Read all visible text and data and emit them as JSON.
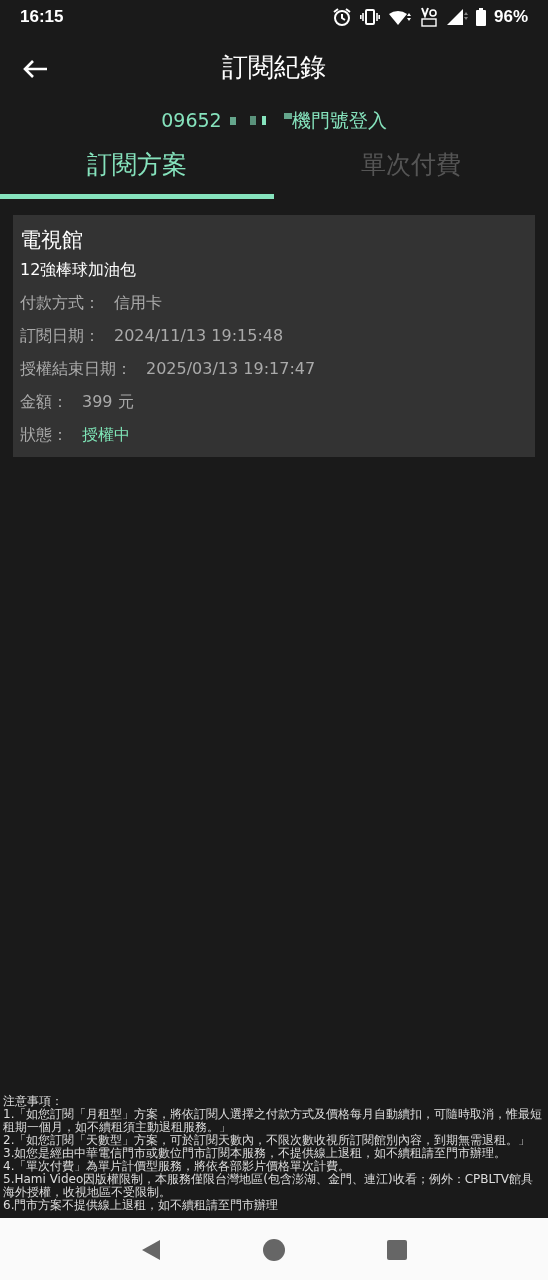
{
  "status_bar": {
    "time": "16:15",
    "battery": "96%"
  },
  "header": {
    "title": "訂閱紀錄"
  },
  "login": {
    "number_prefix": "09652",
    "suffix": "機門號登入"
  },
  "tabs": [
    {
      "label": "訂閱方案",
      "selected": true
    },
    {
      "label": "單次付費",
      "selected": false
    }
  ],
  "subscriptions": [
    {
      "category": "電視館",
      "plan": "12強棒球加油包",
      "fields": [
        {
          "label": "付款方式：",
          "value": "信用卡",
          "kind": "plain"
        },
        {
          "label": "訂閱日期：",
          "value": "2024/11/13 19:15:48",
          "kind": "plain"
        },
        {
          "label": "授權結束日期：",
          "value": "2025/03/13 19:17:47",
          "kind": "plain"
        },
        {
          "label": "金額：",
          "value": "399 元",
          "kind": "plain"
        },
        {
          "label": "狀態：",
          "value": "授權中",
          "kind": "status"
        }
      ]
    }
  ],
  "notes": {
    "heading": "注意事項：",
    "items": [
      "1.「如您訂閱「月租型」方案，將依訂閱人選擇之付款方式及價格每月自動續扣，可隨時取消，惟最短租期一個月，如不續租須主動退租服務。」",
      "2.「如您訂閱「天數型」方案，可於訂閱天數內，不限次數收視所訂閱館別內容，到期無需退租。」",
      "3.如您是經由中華電信門市或數位門市訂閱本服務，不提供線上退租，如不續租請至門市辦理。",
      "4.「單次付費」為單片計價型服務，將依各部影片價格單次計費。",
      "5.Hami Video因版權限制，本服務僅限台灣地區(包含澎湖、金門、連江)收看；例外：CPBLTV館具海外授權，收視地區不受限制。",
      "6.門市方案不提供線上退租，如不續租請至門市辦理"
    ]
  }
}
